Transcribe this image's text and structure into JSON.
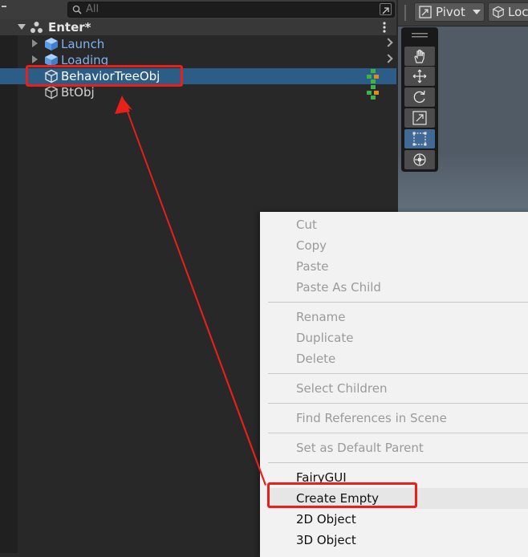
{
  "hierarchy": {
    "search_placeholder": "All",
    "scene_name": "Enter*",
    "items": [
      {
        "label": "Launch",
        "color": "#7fb3ef"
      },
      {
        "label": "Loading",
        "color": "#7fb3ef"
      },
      {
        "label": "BehaviorTreeObj",
        "color": "#ffffff"
      },
      {
        "label": "BtObj",
        "color": "#d2d2d2"
      }
    ]
  },
  "scene_view": {
    "pivot_label": "Pivot",
    "local_label": "Loc"
  },
  "tools": [
    "hand-tool",
    "move-tool",
    "rotate-tool",
    "scale-tool",
    "rect-tool",
    "transform-tool"
  ],
  "context_menu": {
    "group1": [
      "Cut",
      "Copy",
      "Paste",
      "Paste As Child"
    ],
    "group2": [
      "Rename",
      "Duplicate",
      "Delete"
    ],
    "group3": [
      "Select Children"
    ],
    "group4": [
      "Find References in Scene"
    ],
    "group5": [
      "Set as Default Parent"
    ],
    "group6": [
      "FairyGUI",
      "Create Empty",
      "2D Object",
      "3D Object"
    ]
  },
  "colors": {
    "selection": "#2c5d87",
    "annotation": "#e8201a",
    "prefab": "#7fb3ef"
  }
}
